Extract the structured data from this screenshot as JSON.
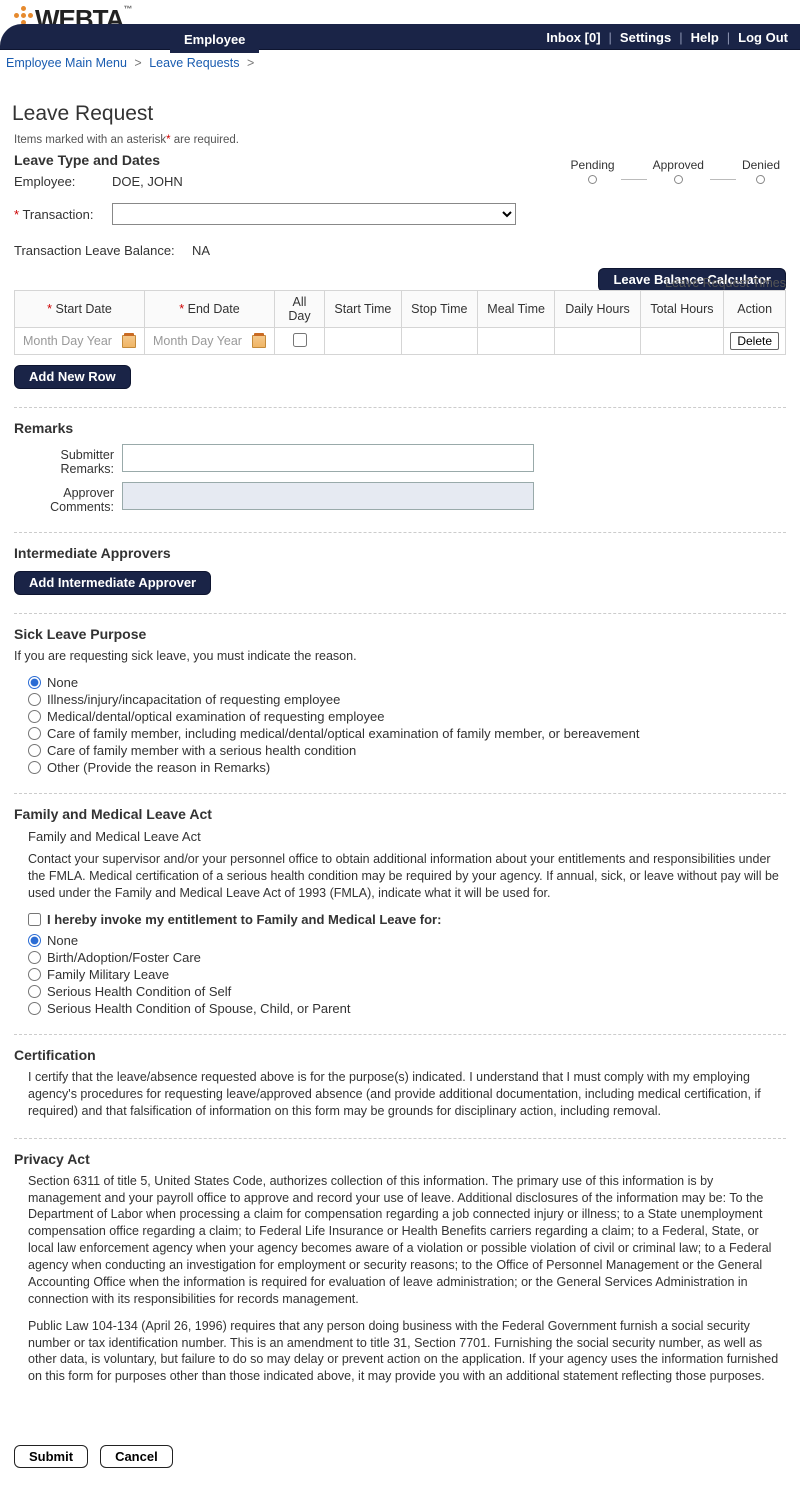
{
  "logo": {
    "text1": "WEB",
    "text2": "TA",
    "tm": "™"
  },
  "nav": {
    "tab": "Employee",
    "inbox": "Inbox [0]",
    "settings": "Settings",
    "help": "Help",
    "logout": "Log Out"
  },
  "crumb": {
    "a": "Employee Main Menu",
    "b": "Leave Requests"
  },
  "status": [
    "Pending",
    "Approved",
    "Denied"
  ],
  "title": "Leave Request",
  "calc_btn": "Leave Balance Calculator",
  "required_note": "Items marked with an asterisk* are required.",
  "section_types": "Leave Type and Dates",
  "employee_label": "Employee:",
  "employee_name": "DOE, JOHN",
  "transaction_label": "Transaction:",
  "balance_label": "Transaction Leave Balance:",
  "balance_value": "NA",
  "table": {
    "caption": "Leave Request Times",
    "headers": [
      "Start Date",
      "End Date",
      "All Day",
      "Start Time",
      "Stop Time",
      "Meal Time",
      "Daily Hours",
      "Total Hours",
      "Action"
    ],
    "date_placeholder": "Month Day Year",
    "delete": "Delete"
  },
  "add_row": "Add New Row",
  "remarks": {
    "heading": "Remarks",
    "submitter": "Submitter Remarks:",
    "approver": "Approver Comments:"
  },
  "intermediate": {
    "heading": "Intermediate Approvers",
    "btn": "Add Intermediate Approver"
  },
  "sick": {
    "heading": "Sick Leave Purpose",
    "intro": "If you are requesting sick leave, you must indicate the reason.",
    "options": [
      "None",
      "Illness/injury/incapacitation of requesting employee",
      "Medical/dental/optical examination of requesting employee",
      "Care of family member, including medical/dental/optical examination of family member, or bereavement",
      "Care of family member with a serious health condition",
      "Other (Provide the reason in Remarks)"
    ]
  },
  "fmla": {
    "heading": "Family and Medical Leave Act",
    "sub": "Family and Medical Leave Act",
    "para": "Contact your supervisor and/or your personnel office to obtain additional information about your entitlements and responsibilities under the FMLA. Medical certification of a serious health condition may be required by your agency. If annual, sick, or leave without pay will be used under the Family and Medical Leave Act of 1993 (FMLA), indicate what it will be used for.",
    "invoke": "I hereby invoke my entitlement to Family and Medical Leave for:",
    "options": [
      "None",
      "Birth/Adoption/Foster Care",
      "Family Military Leave",
      "Serious Health Condition of Self",
      "Serious Health Condition of Spouse, Child, or Parent"
    ]
  },
  "cert": {
    "heading": "Certification",
    "text": "I certify that the leave/absence requested above is for the purpose(s) indicated. I understand that I must comply with my employing agency's procedures for requesting leave/approved absence (and provide additional documentation, including medical certification, if required) and that falsification of information on this form may be grounds for disciplinary action, including removal."
  },
  "privacy": {
    "heading": "Privacy Act",
    "p1": "Section 6311 of title 5, United States Code, authorizes collection of this information. The primary use of this information is by management and your payroll office to approve and record your use of leave. Additional disclosures of the information may be: To the Department of Labor when processing a claim for compensation regarding a job connected injury or illness; to a State unemployment compensation office regarding a claim; to Federal Life Insurance or Health Benefits carriers regarding a claim; to a Federal, State, or local law enforcement agency when your agency becomes aware of a violation or possible violation of civil or criminal law; to a Federal agency when conducting an investigation for employment or security reasons; to the Office of Personnel Management or the General Accounting Office when the information is required for evaluation of leave administration; or the General Services Administration in connection with its responsibilities for records management.",
    "p2": "Public Law 104-134 (April 26, 1996) requires that any person doing business with the Federal Government furnish a social security number or tax identification number. This is an amendment to title 31, Section 7701. Furnishing the social security number, as well as other data, is voluntary, but failure to do so may delay or prevent action on the application. If your agency uses the information furnished on this form for purposes other than those indicated above, it may provide you with an additional statement reflecting those purposes."
  },
  "buttons": {
    "submit": "Submit",
    "cancel": "Cancel"
  }
}
